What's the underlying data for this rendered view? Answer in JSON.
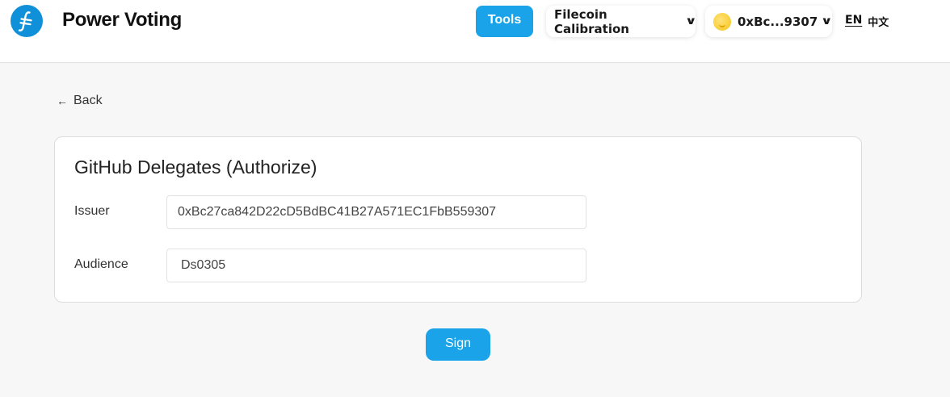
{
  "header": {
    "app_title": "Power Voting",
    "logo_icon": "filecoin-logo",
    "tools_label": "Tools",
    "network_label": "Filecoin Calibration",
    "wallet_address": "0xBc...9307",
    "lang_en": "EN",
    "lang_zh": "中文"
  },
  "nav": {
    "back_label": "Back"
  },
  "form": {
    "title": "GitHub Delegates (Authorize)",
    "issuer_label": "Issuer",
    "issuer_value": "0xBc27ca842D22cD5BdBC41B27A571EC1FbB559307",
    "audience_label": "Audience",
    "audience_value": "Ds0305",
    "sign_label": "Sign"
  },
  "colors": {
    "accent": "#1aa3e8",
    "logo": "#0f90d8",
    "background": "#f7f7f8"
  }
}
